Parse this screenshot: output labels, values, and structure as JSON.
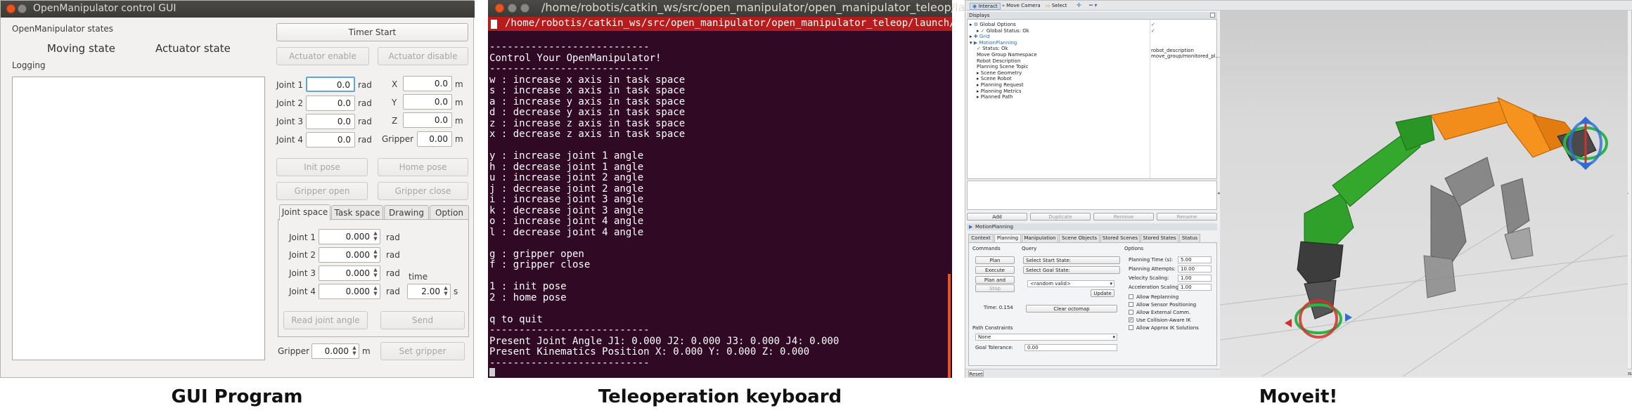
{
  "gui": {
    "window_title": "OpenManipulator control GUI",
    "states_label": "OpenManipulator states",
    "moving_state": "Moving state",
    "actuator_state": "Actuator state",
    "logging_label": "Logging",
    "timer_start": "Timer Start",
    "actuator_enable": "Actuator enable",
    "actuator_disable": "Actuator disable",
    "joints": [
      {
        "label": "Joint 1",
        "value": "0.0",
        "unit": "rad"
      },
      {
        "label": "Joint 2",
        "value": "0.0",
        "unit": "rad"
      },
      {
        "label": "Joint 3",
        "value": "0.0",
        "unit": "rad"
      },
      {
        "label": "Joint 4",
        "value": "0.0",
        "unit": "rad"
      }
    ],
    "positions": [
      {
        "label": "X",
        "value": "0.0",
        "unit": "m"
      },
      {
        "label": "Y",
        "value": "0.0",
        "unit": "m"
      },
      {
        "label": "Z",
        "value": "0.0",
        "unit": "m"
      }
    ],
    "gripper_label": "Gripper",
    "gripper_value": "0.00",
    "init_pose": "Init pose",
    "home_pose": "Home pose",
    "gripper_open": "Gripper open",
    "gripper_close": "Gripper close",
    "tabs": [
      "Joint space",
      "Task space",
      "Drawing",
      "Option"
    ],
    "joint_space": [
      {
        "label": "Joint 1",
        "value": "0.000",
        "unit": "rad"
      },
      {
        "label": "Joint 2",
        "value": "0.000",
        "unit": "rad"
      },
      {
        "label": "Joint 3",
        "value": "0.000",
        "unit": "rad"
      },
      {
        "label": "Joint 4",
        "value": "0.000",
        "unit": "rad"
      }
    ],
    "time_label": "time",
    "time_value": "2.00",
    "time_unit": "s",
    "read_joint_angle": "Read joint angle",
    "send": "Send",
    "bottom_gripper_label": "Gripper",
    "bottom_gripper_value": "0.000",
    "bottom_gripper_unit": "m",
    "set_gripper": "Set gripper"
  },
  "terminal": {
    "title": "/home/robotis/catkin_ws/src/open_manipulator/open_manipulator_teleop/la",
    "command": "/home/robotis/catkin_ws/src/open_manipulator/open_manipulator_teleop/launch/open_manipul",
    "lines": [
      "---------------------------",
      "Control Your OpenManipulator!",
      "---------------------------",
      "w : increase x axis in task space",
      "s : increase x axis in task space",
      "a : increase y axis in task space",
      "d : decrease y axis in task space",
      "z : increase z axis in task space",
      "x : decrease z axis in task space",
      "",
      "y : increase joint 1 angle",
      "h : decrease joint 1 angle",
      "u : increase joint 2 angle",
      "j : decrease joint 2 angle",
      "i : increase joint 3 angle",
      "k : decrease joint 3 angle",
      "o : increase joint 4 angle",
      "l : decrease joint 4 angle",
      "",
      "g : gripper open",
      "f : gripper close",
      "",
      "1 : init pose",
      "2 : home pose",
      "",
      "q to quit",
      "---------------------------",
      "Present Joint Angle J1: 0.000 J2: 0.000 J3: 0.000 J4: 0.000",
      "Present Kinematics Position X: 0.000 Y: 0.000 Z: 0.000",
      "---------------------------"
    ]
  },
  "rviz": {
    "toolbar": [
      "Interact",
      "Move Camera",
      "Select"
    ],
    "displays_title": "Displays",
    "tree": [
      "Global Options",
      "Global Status: Ok",
      "Grid",
      "MotionPlanning",
      "Status: Ok",
      "Move Group Namespace",
      "Robot Description",
      "Planning Scene Topic",
      "Scene Geometry",
      "Scene Robot",
      "Planning Request",
      "Planning Metrics",
      "Planned Path"
    ],
    "tree_values": {
      "robot_description": "robot_description",
      "planning_scene_topic": "move_group/monitored_pl..."
    },
    "add": "Add",
    "duplicate": "Duplicate",
    "remove": "Remove",
    "rename": "Rename",
    "mp_title": "MotionPlanning",
    "mp_tabs": [
      "Context",
      "Planning",
      "Manipulation",
      "Scene Objects",
      "Stored Scenes",
      "Stored States",
      "Status"
    ],
    "commands_label": "Commands",
    "query_label": "Query",
    "options_label": "Options",
    "plan": "Plan",
    "execute": "Execute",
    "plan_execute": "Plan and Execute",
    "stop": "Stop",
    "time_label": "Time: 0.154",
    "select_start": "Select Start State:",
    "select_goal": "Select Goal State:",
    "goal_value": "<random valid>",
    "update": "Update",
    "clear_octomap": "Clear octomap",
    "options": [
      {
        "label": "Planning Time (s):",
        "value": "5.00"
      },
      {
        "label": "Planning Attempts:",
        "value": "10.00"
      },
      {
        "label": "Velocity Scaling:",
        "value": "1.00"
      },
      {
        "label": "Acceleration Scaling:",
        "value": "1.00"
      }
    ],
    "checks": [
      {
        "label": "Allow Replanning",
        "checked": false
      },
      {
        "label": "Allow Sensor Positioning",
        "checked": false
      },
      {
        "label": "Allow External Comm.",
        "checked": false
      },
      {
        "label": "Use Collision-Aware IK",
        "checked": true
      },
      {
        "label": "Allow Approx IK Solutions",
        "checked": false
      }
    ],
    "path_constraints": "Path Constraints",
    "none": "None",
    "goal_tolerance": "Goal Tolerance:",
    "goal_tolerance_value": "0.00",
    "reset": "Reset",
    "fps": "31 fps"
  },
  "captions": [
    "GUI Program",
    "Teleoperation keyboard",
    "Moveit!"
  ],
  "colors": {
    "ubuntu_orange": "#e95420",
    "terminal_bg": "#300a24",
    "rviz_bg": "#eff0f1"
  }
}
